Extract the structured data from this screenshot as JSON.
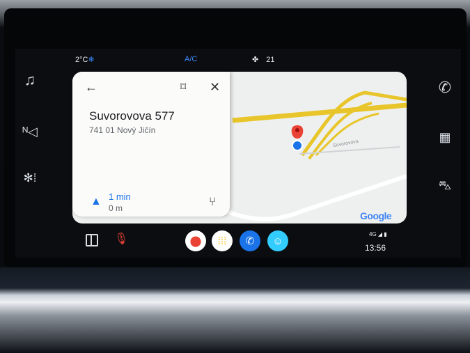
{
  "status": {
    "temperature": "2°C",
    "ac_label": "A/C",
    "fan_level": "21",
    "network": "4G",
    "clock": "13:56"
  },
  "destination": {
    "name": "Suvorovova 577",
    "locality": "741 01 Nový Jičín",
    "eta": "1 min",
    "distance": "0 m"
  },
  "map": {
    "street_label": "Suvorovova",
    "attribution": "Google"
  },
  "icons": {
    "left_rail": [
      "music-note-icon",
      "navigation-icon",
      "climate-fan-icon"
    ],
    "right_rail": [
      "phone-icon",
      "apps-grid-icon",
      "car-icon"
    ],
    "dock": [
      "google-maps-icon",
      "podcast-icon",
      "phone-app-icon",
      "waze-icon"
    ]
  },
  "colors": {
    "route_road": "#e8c52a",
    "pin_red": "#ea4335",
    "location_blue": "#1a73e8",
    "eta_blue": "#1a73e8"
  }
}
